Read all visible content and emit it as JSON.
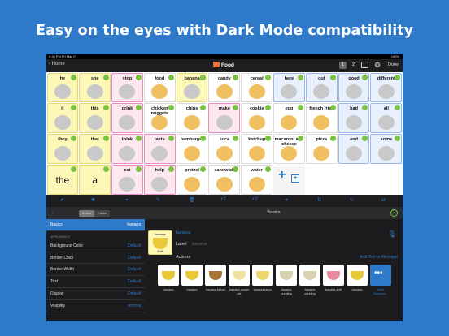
{
  "headline": "Easy on the eyes with Dark Mode compatibility",
  "status": {
    "time": "5:34 PM Fri Mar 27",
    "battery": "100%"
  },
  "nav": {
    "back": "Home",
    "title": "Food",
    "pages": [
      "1",
      "2"
    ],
    "done": "Done"
  },
  "cells": [
    {
      "label": "he",
      "style": "y"
    },
    {
      "label": "she",
      "style": "y"
    },
    {
      "label": "stop",
      "style": "pk"
    },
    {
      "label": "food",
      "style": "w"
    },
    {
      "label": "banana",
      "style": "y"
    },
    {
      "label": "candy",
      "style": "w"
    },
    {
      "label": "cereal",
      "style": "w"
    },
    {
      "label": "here",
      "style": "bl"
    },
    {
      "label": "out",
      "style": "bl"
    },
    {
      "label": "good",
      "style": "bl"
    },
    {
      "label": "different",
      "style": "bl"
    },
    {
      "label": "it",
      "style": "y"
    },
    {
      "label": "this",
      "style": "y"
    },
    {
      "label": "drink",
      "style": "pk"
    },
    {
      "label": "chicken nuggets",
      "style": "w"
    },
    {
      "label": "chips",
      "style": "w"
    },
    {
      "label": "make",
      "style": "pk"
    },
    {
      "label": "cookie",
      "style": "w"
    },
    {
      "label": "egg",
      "style": "w"
    },
    {
      "label": "french fries",
      "style": "w"
    },
    {
      "label": "bad",
      "style": "bl"
    },
    {
      "label": "all",
      "style": "bl"
    },
    {
      "label": "they",
      "style": "y"
    },
    {
      "label": "that",
      "style": "y"
    },
    {
      "label": "think",
      "style": "pk"
    },
    {
      "label": "taste",
      "style": "pk"
    },
    {
      "label": "hamburger",
      "style": "w"
    },
    {
      "label": "juice",
      "style": "w"
    },
    {
      "label": "ketchup",
      "style": "w"
    },
    {
      "label": "macaroni and cheese",
      "style": "w"
    },
    {
      "label": "pizza",
      "style": "w"
    },
    {
      "label": "and",
      "style": "bl"
    },
    {
      "label": "some",
      "style": "bl"
    },
    {
      "label": "the",
      "style": "y",
      "big": true
    },
    {
      "label": "a",
      "style": "y",
      "big": true
    },
    {
      "label": "eat",
      "style": "pk"
    },
    {
      "label": "help",
      "style": "pk"
    },
    {
      "label": "pretzel",
      "style": "w"
    },
    {
      "label": "sandwich",
      "style": "w"
    },
    {
      "label": "water",
      "style": "w"
    }
  ],
  "toolbar": [
    "+1",
    "+2"
  ],
  "left": {
    "segments": [
      "Button",
      "Folder"
    ],
    "basics": "Basics",
    "basics_val": "banana",
    "section": "APPEARANCE",
    "rows": [
      {
        "k": "Background Color",
        "v": "Default"
      },
      {
        "k": "Border Color",
        "v": "Default"
      },
      {
        "k": "Border Width",
        "v": "Default"
      },
      {
        "k": "Text",
        "v": "Default"
      },
      {
        "k": "Display",
        "v": "Default"
      },
      {
        "k": "Visibility",
        "v": "Normal"
      }
    ]
  },
  "right": {
    "title": "Basics",
    "word": "banana",
    "label": "Label",
    "label_val": "banana",
    "thumb_cap": "Edit",
    "actions": "Actions",
    "add_text": "Add Text to Message",
    "results": [
      {
        "cap": "banana",
        "color": "#e9c839"
      },
      {
        "cap": "banana",
        "color": "#e9c839"
      },
      {
        "cap": "banana bread",
        "color": "#a8743a"
      },
      {
        "cap": "banana cream pie",
        "color": "#f2e2a0"
      },
      {
        "cap": "banana piece",
        "color": "#efd66a"
      },
      {
        "cap": "banana pudding",
        "color": "#d9d1b0"
      },
      {
        "cap": "banana pudding",
        "color": "#d9d1b0"
      },
      {
        "cap": "banana split",
        "color": "#e88aa0"
      },
      {
        "cap": "banana",
        "color": "#e9c839"
      }
    ],
    "more": "More Symbols..."
  }
}
